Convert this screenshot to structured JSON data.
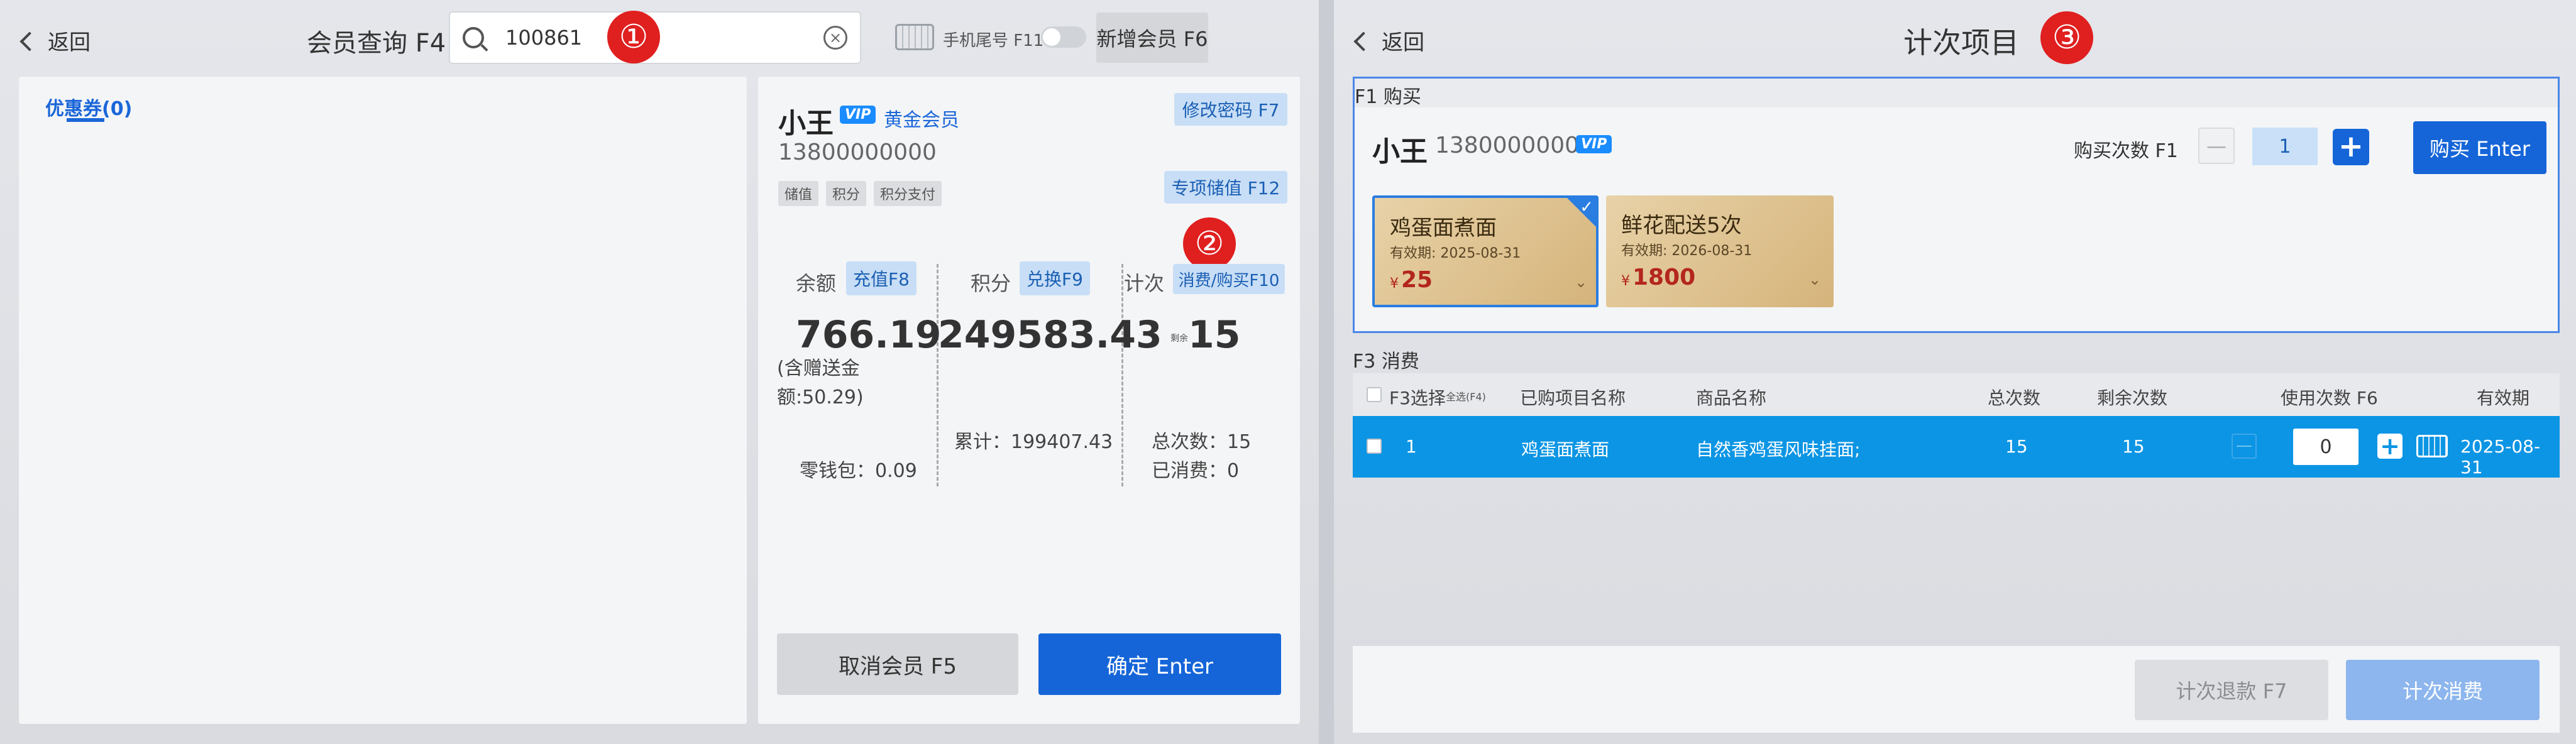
{
  "screen1": {
    "back_label": "返回",
    "title": "会员查询 F4",
    "search_value": "100861",
    "clear_glyph": "×",
    "annotation": "①",
    "phone_tail_label": "手机尾号 F11",
    "add_member_label": "新增会员 F6",
    "coupon_tab": "优惠券(0)",
    "member": {
      "name": "小王",
      "vip_badge": "VIP",
      "level": "黄金会员",
      "phone": "13800000000",
      "tags": [
        "储值",
        "积分",
        "积分支付"
      ],
      "change_password": "修改密码 F7",
      "special_deposit": "专项储值 F12",
      "annotation": "②"
    },
    "balance": {
      "label": "余额",
      "recharge": "充值F8",
      "amount": "766.19",
      "note": "(含赠送金额:50.29)",
      "wallet": "零钱包：0.09"
    },
    "points": {
      "label": "积分",
      "exchange": "兑换F9",
      "amount": "249583.43",
      "accumulated": "累计：199407.43"
    },
    "count": {
      "label": "计次",
      "action": "消费/购买F10",
      "prefix": "剩余",
      "amount": "15",
      "total": "总次数：15",
      "used": "已消费：0"
    },
    "cancel_button": "取消会员 F5",
    "confirm_button": "确定 Enter"
  },
  "screen2": {
    "back_label": "返回",
    "title": "计次项目",
    "annotation": "③",
    "buy_section": "F1 购买",
    "member_name": "小王",
    "member_phone": "13800000000",
    "vip_badge": "VIP",
    "buy_count_label": "购买次数 F1",
    "minus_glyph": "—",
    "buy_count": "1",
    "plus_glyph": "+",
    "buy_button": "购买 Enter",
    "cards": [
      {
        "name": "鸡蛋面煮面",
        "validity": "有效期: 2025-08-31",
        "yen": "¥",
        "price": "25",
        "selected": true
      },
      {
        "name": "鲜花配送5次",
        "validity": "有效期: 2026-08-31",
        "yen": "¥",
        "price": "1800",
        "selected": false
      }
    ],
    "consume_section": "F3 消费",
    "table": {
      "headers": {
        "select": "F3选择",
        "select_small": "全选(F4)",
        "item": "已购项目名称",
        "product": "商品名称",
        "total": "总次数",
        "remaining": "剩余次数",
        "use": "使用次数 F6",
        "validity": "有效期"
      },
      "rows": [
        {
          "index": "1",
          "item": "鸡蛋面煮面",
          "product": "自然香鸡蛋风味挂面;",
          "total": "15",
          "remaining": "15",
          "use": "0",
          "validity": "2025-08-31"
        }
      ]
    },
    "refund_button": "计次退款 F7",
    "consume_button": "计次消费"
  },
  "colors": {
    "primary": "#1565d8",
    "row_selected": "#0c95e4",
    "annotation_red": "#e01f1f",
    "price_red": "#b3261e"
  }
}
